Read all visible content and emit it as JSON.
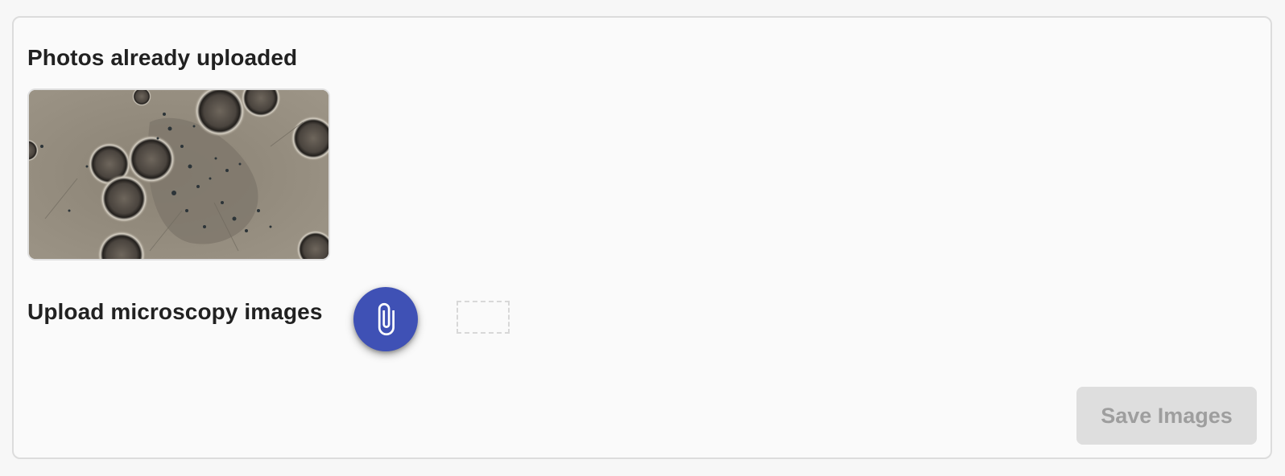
{
  "uploaded_section": {
    "title": "Photos already uploaded",
    "images": [
      {
        "alt": "microscopy-image"
      }
    ]
  },
  "upload_section": {
    "title": "Upload microscopy images",
    "attach_icon": "paperclip-icon"
  },
  "actions": {
    "save_label": "Save Images",
    "save_disabled": true
  },
  "colors": {
    "accent": "#3f51b5",
    "disabled_bg": "#dedede",
    "disabled_text": "#9e9e9e",
    "card_border": "#dcdcdc"
  }
}
